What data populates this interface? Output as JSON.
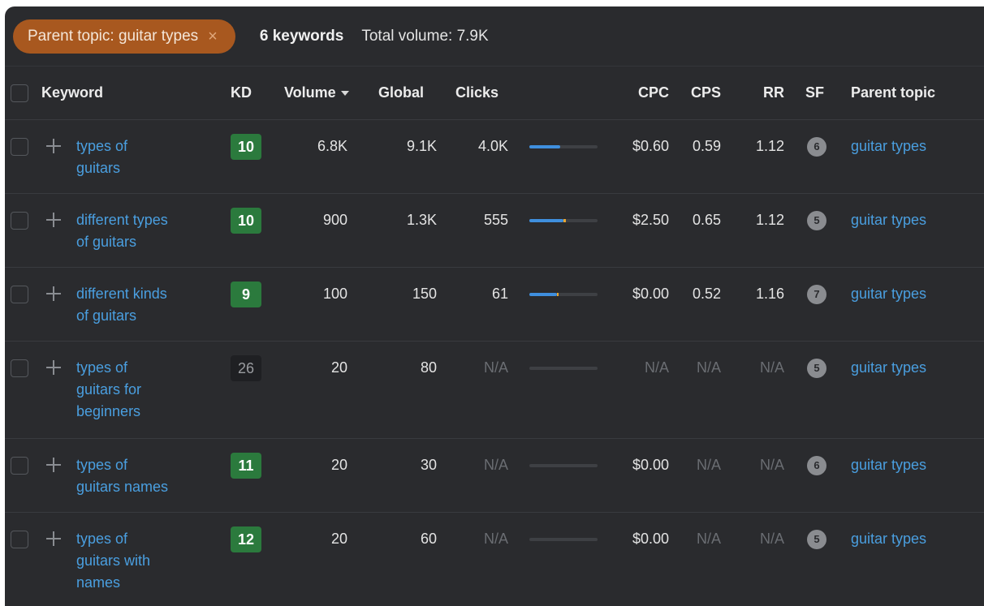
{
  "filter": {
    "chip_label": "Parent topic: guitar types",
    "close_glyph": "×",
    "keyword_count": "6 keywords",
    "total_volume": "Total volume: 7.9K"
  },
  "columns": {
    "keyword": "Keyword",
    "kd": "KD",
    "volume": "Volume",
    "global": "Global",
    "clicks": "Clicks",
    "cpc": "CPC",
    "cps": "CPS",
    "rr": "RR",
    "sf": "SF",
    "parent_topic": "Parent topic"
  },
  "colors": {
    "kd_green": "#2b7a3d",
    "link": "#4a9fe0",
    "chip": "#a8581f",
    "clicks_bar_organic": "#3f8fde",
    "clicks_bar_paid": "#e8a531"
  },
  "rows": [
    {
      "keyword_lines": [
        "types of",
        "guitars"
      ],
      "kd": "10",
      "kd_style": "green",
      "volume": "6.8K",
      "global": "9.1K",
      "clicks": "4.0K",
      "clicks_bar_fraction": 0.45,
      "clicks_bar_paid_fraction": 0,
      "cpc": "$0.60",
      "cps": "0.59",
      "rr": "1.12",
      "sf": "6",
      "parent_topic": "guitar types"
    },
    {
      "keyword_lines": [
        "different types",
        "of guitars"
      ],
      "kd": "10",
      "kd_style": "green",
      "volume": "900",
      "global": "1.3K",
      "clicks": "555",
      "clicks_bar_fraction": 0.5,
      "clicks_bar_paid_fraction": 0.03,
      "cpc": "$2.50",
      "cps": "0.65",
      "rr": "1.12",
      "sf": "5",
      "parent_topic": "guitar types"
    },
    {
      "keyword_lines": [
        "different kinds",
        "of guitars"
      ],
      "kd": "9",
      "kd_style": "green",
      "volume": "100",
      "global": "150",
      "clicks": "61",
      "clicks_bar_fraction": 0.4,
      "clicks_bar_paid_fraction": 0.03,
      "cpc": "$0.00",
      "cps": "0.52",
      "rr": "1.16",
      "sf": "7",
      "parent_topic": "guitar types"
    },
    {
      "keyword_lines": [
        "types of",
        "guitars for",
        "beginners"
      ],
      "kd": "26",
      "kd_style": "dark",
      "volume": "20",
      "global": "80",
      "clicks": "N/A",
      "clicks_bar_fraction": 0,
      "clicks_bar_paid_fraction": 0,
      "cpc": "N/A",
      "cps": "N/A",
      "rr": "N/A",
      "sf": "5",
      "parent_topic": "guitar types"
    },
    {
      "keyword_lines": [
        "types of",
        "guitars names"
      ],
      "kd": "11",
      "kd_style": "green",
      "volume": "20",
      "global": "30",
      "clicks": "N/A",
      "clicks_bar_fraction": 0,
      "clicks_bar_paid_fraction": 0,
      "cpc": "$0.00",
      "cps": "N/A",
      "rr": "N/A",
      "sf": "6",
      "parent_topic": "guitar types"
    },
    {
      "keyword_lines": [
        "types of",
        "guitars with",
        "names"
      ],
      "kd": "12",
      "kd_style": "green",
      "volume": "20",
      "global": "60",
      "clicks": "N/A",
      "clicks_bar_fraction": 0,
      "clicks_bar_paid_fraction": 0,
      "cpc": "$0.00",
      "cps": "N/A",
      "rr": "N/A",
      "sf": "5",
      "parent_topic": "guitar types"
    }
  ]
}
